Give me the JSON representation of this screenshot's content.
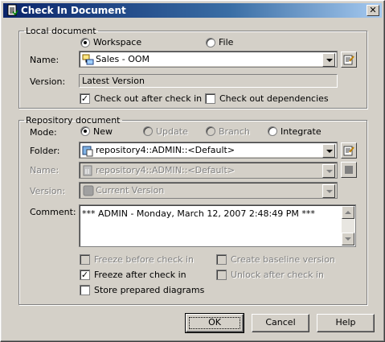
{
  "window": {
    "title": "Check In Document",
    "close_label": "✕"
  },
  "local": {
    "legend": "Local document",
    "radio_workspace": "Workspace",
    "radio_file": "File",
    "name_label": "Name:",
    "name_value": "Sales - OOM",
    "version_label": "Version:",
    "version_value": "Latest Version",
    "checkout_after": "Check out after check in",
    "checkout_dependencies": "Check out dependencies"
  },
  "repo": {
    "legend": "Repository document",
    "mode_label": "Mode:",
    "mode_new": "New",
    "mode_update": "Update",
    "mode_branch": "Branch",
    "mode_integrate": "Integrate",
    "folder_label": "Folder:",
    "folder_value": "repository4::ADMIN::<Default>",
    "name_label": "Name:",
    "name_value": "repository4::ADMIN::<Default>",
    "version_label": "Version:",
    "version_value": "Current Version",
    "comment_label": "Comment:",
    "comment_value": "*** ADMIN - Monday, March 12, 2007 2:48:49 PM ***",
    "freeze_before": "Freeze before check in",
    "create_baseline": "Create baseline version",
    "freeze_after": "Freeze after check in",
    "unlock_after": "Unlock after check in",
    "store_prepared": "Store prepared diagrams"
  },
  "buttons": {
    "ok": "OK",
    "cancel": "Cancel",
    "help": "Help"
  },
  "checked_mark": "✓"
}
